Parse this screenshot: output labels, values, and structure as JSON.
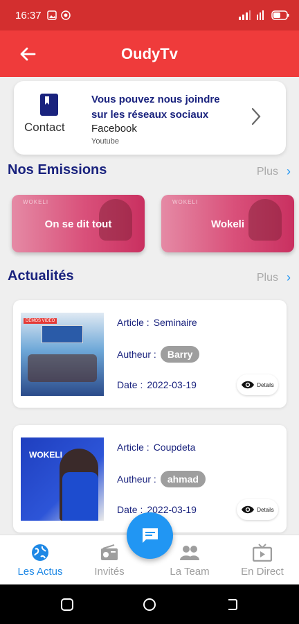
{
  "status_bar": {
    "time": "16:37"
  },
  "app_bar": {
    "title": "OudyTv"
  },
  "contact": {
    "label": "Contact",
    "message": "Vous pouvez nous joindre sur les réseaux sociaux",
    "facebook": "Facebook",
    "youtube": "Youtube"
  },
  "emissions": {
    "title": "Nos Emissions",
    "more": "Plus",
    "items": [
      {
        "label": "On se dit tout",
        "deco": "WOKELI"
      },
      {
        "label": "Wokeli",
        "deco": "WOKELI"
      }
    ]
  },
  "actualites": {
    "title": "Actualités",
    "more": "Plus",
    "keys": {
      "article": "Article :",
      "author": "Autheur :",
      "date": "Date :"
    },
    "details_label": "Details",
    "items": [
      {
        "article": "Seminaire",
        "author": "Barry",
        "date": "2022-03-19",
        "thumb_tag": "DEMOS VIDEO"
      },
      {
        "article": "Coupdeta",
        "author": "ahmad",
        "date": "2022-03-19",
        "thumb_tag": "WOKELI"
      }
    ]
  },
  "bottom_nav": {
    "items": [
      {
        "label": "Les Actus",
        "icon": "globe-icon",
        "active": true
      },
      {
        "label": "Invités",
        "icon": "radio-icon",
        "active": false
      },
      {
        "label": "La Team",
        "icon": "people-icon",
        "active": false
      },
      {
        "label": "En Direct",
        "icon": "live-tv-icon",
        "active": false
      }
    ]
  },
  "colors": {
    "primary": "#ef3b3b",
    "statusbar": "#d32f2f",
    "accent": "#2196f3",
    "heading": "#1a237e"
  }
}
